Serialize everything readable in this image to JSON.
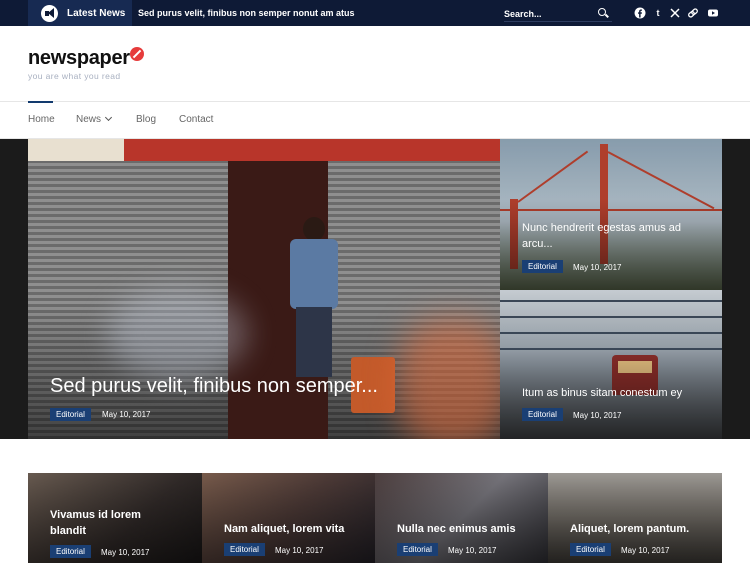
{
  "topbar": {
    "latest_label": "Latest News",
    "ticker": "Sed purus velit, finibus non semper nonut am atus",
    "search_placeholder": "Search...",
    "social_icons": [
      "facebook-icon",
      "tumblr-icon",
      "x-icon",
      "link-icon",
      "youtube-icon"
    ]
  },
  "header": {
    "logo": "newspaper",
    "tagline": "you are what you read"
  },
  "nav": {
    "items": [
      {
        "label": "Home"
      },
      {
        "label": "News"
      },
      {
        "label": "Blog"
      },
      {
        "label": "Contact"
      }
    ]
  },
  "hero": {
    "main": {
      "title": "Sed purus velit, finibus non semper...",
      "category": "Editorial",
      "date": "May 10, 2017"
    },
    "side": [
      {
        "title_line1": "Nunc hendrerit egestas amus ad",
        "title_line2": "arcu...",
        "category": "Editorial",
        "date": "May 10, 2017"
      },
      {
        "title_line1": "Itum as binus sitam conestum ey",
        "title_line2": "",
        "category": "Editorial",
        "date": "May 10, 2017"
      }
    ]
  },
  "cards": [
    {
      "title_line1": "Vivamus id lorem",
      "title_line2": "blandit",
      "category": "Editorial",
      "date": "May 10, 2017"
    },
    {
      "title_line1": "Nam aliquet, lorem vita",
      "title_line2": "",
      "category": "Editorial",
      "date": "May 10, 2017"
    },
    {
      "title_line1": "Nulla nec enimus amis",
      "title_line2": "",
      "category": "Editorial",
      "date": "May 10, 2017"
    },
    {
      "title_line1": "Aliquet, lorem pantum.",
      "title_line2": "",
      "category": "Editorial",
      "date": "May 10, 2017"
    }
  ],
  "colors": {
    "topbar_bg": "#0e1a36",
    "badge": "#1a3f74",
    "logo_mark": "#e63b3b"
  }
}
